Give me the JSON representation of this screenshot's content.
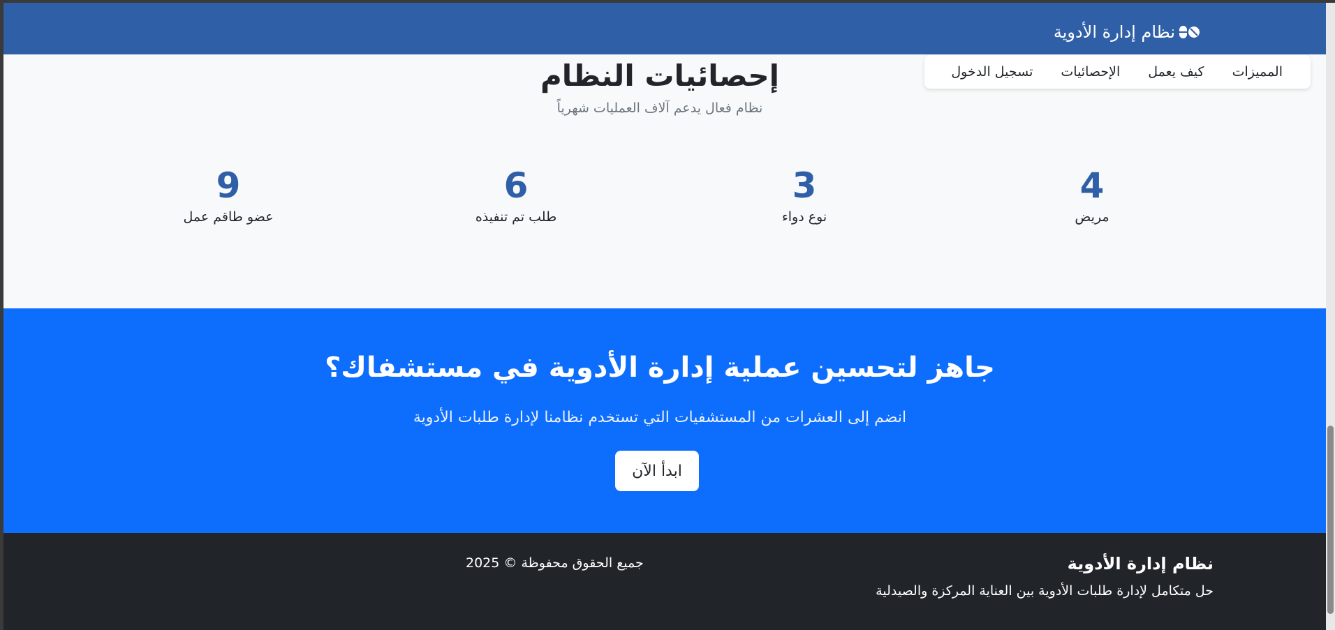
{
  "header": {
    "brand_icon": "pills-icon",
    "brand_title": "نظام إدارة الأدوية"
  },
  "nav": {
    "items": [
      {
        "label": "المميزات"
      },
      {
        "label": "كيف يعمل"
      },
      {
        "label": "الإحصائيات"
      },
      {
        "label": "تسجيل الدخول"
      }
    ]
  },
  "stats": {
    "title": "إحصائيات النظام",
    "subtitle": "نظام فعال يدعم آلاف العمليات شهرياً",
    "items": [
      {
        "value": "4",
        "label": "مريض"
      },
      {
        "value": "3",
        "label": "نوع دواء"
      },
      {
        "value": "6",
        "label": "طلب تم تنفيذه"
      },
      {
        "value": "9",
        "label": "عضو طاقم عمل"
      }
    ]
  },
  "cta": {
    "title": "جاهز لتحسين عملية إدارة الأدوية في مستشفاك؟",
    "subtitle": "انضم إلى العشرات من المستشفيات التي تستخدم نظامنا لإدارة طلبات الأدوية",
    "button_label": "ابدأ الآن"
  },
  "footer": {
    "title": "نظام إدارة الأدوية",
    "description": "حل متكامل لإدارة طلبات الأدوية بين العناية المركزة والصيدلية",
    "copyright": "جميع الحقوق محفوظة © 2025"
  },
  "colors": {
    "header_bg": "#2f5fa7",
    "cta_bg": "#0d6efd",
    "footer_bg": "#212529",
    "stat_number": "#2f5fa7"
  }
}
